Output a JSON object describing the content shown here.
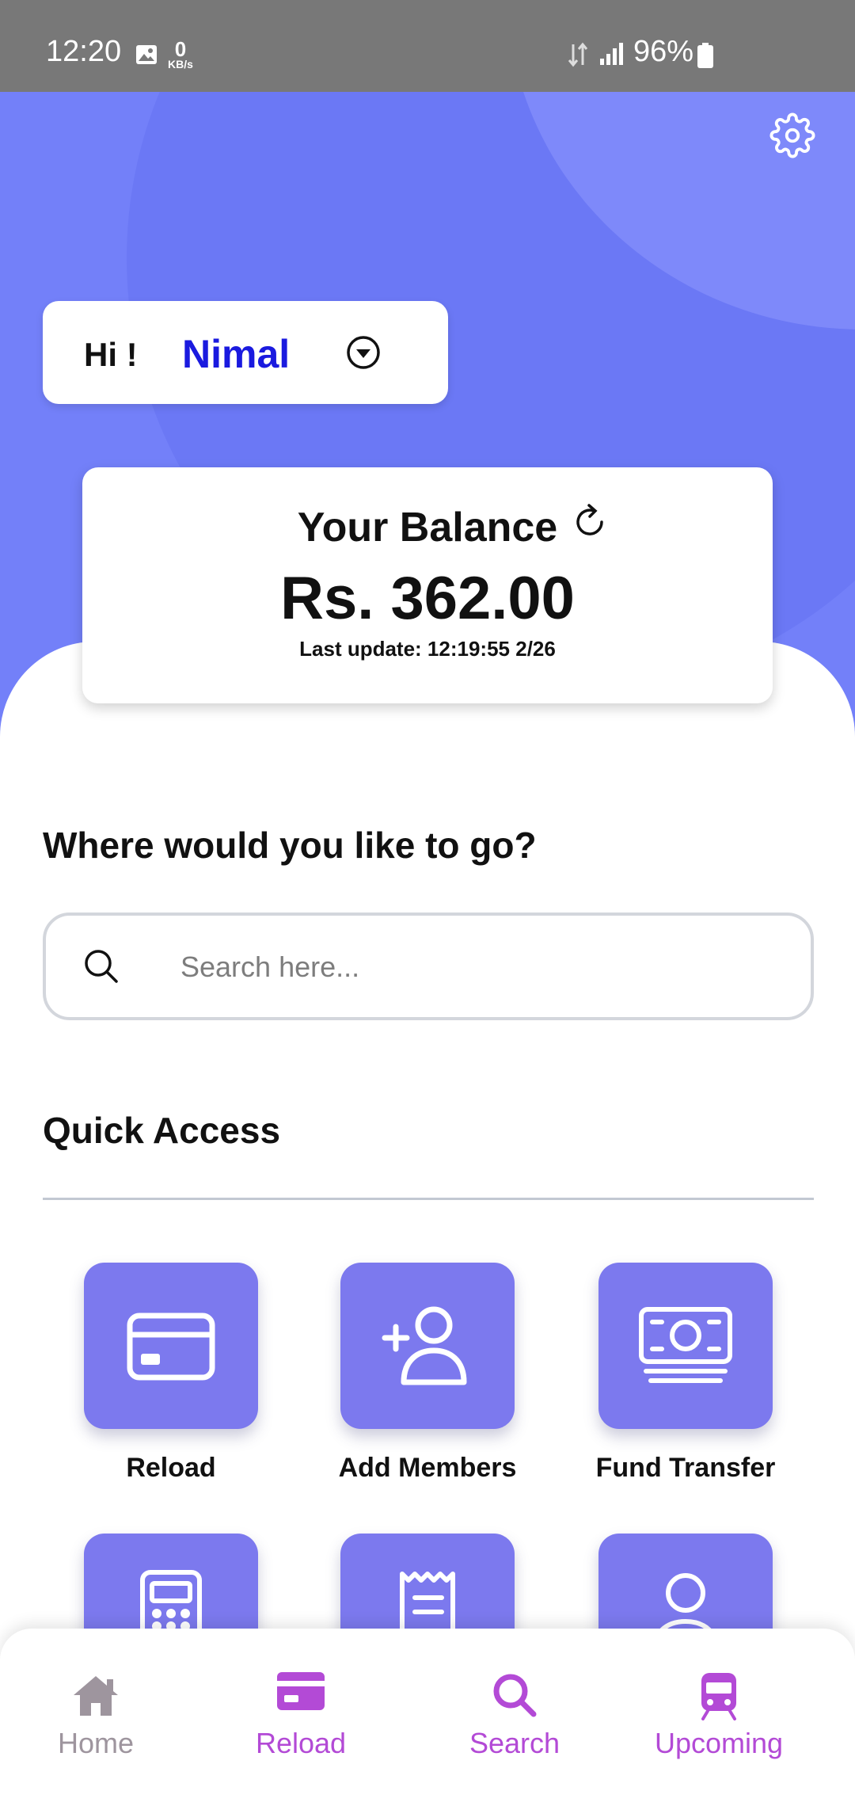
{
  "status_bar": {
    "time": "12:20",
    "speed_value": "0",
    "speed_unit": "KB/s",
    "battery": "96%"
  },
  "greeting": {
    "hi": "Hi !",
    "name": "Nimal"
  },
  "balance": {
    "title": "Your Balance",
    "amount": "Rs. 362.00",
    "last_update": "Last update: 12:19:55 2/26"
  },
  "destination": {
    "title": "Where would you like to go?",
    "search_placeholder": "Search here..."
  },
  "quick_access": {
    "title": "Quick Access",
    "items": [
      {
        "label": "Reload",
        "icon": "card-icon"
      },
      {
        "label": "Add Members",
        "icon": "add-user-icon"
      },
      {
        "label": "Fund Transfer",
        "icon": "cash-icon"
      },
      {
        "label": "",
        "icon": "calculator-icon"
      },
      {
        "label": "",
        "icon": "receipt-icon"
      },
      {
        "label": "",
        "icon": "profile-icon"
      }
    ]
  },
  "bottom_nav": {
    "items": [
      {
        "label": "Home",
        "icon": "home-icon"
      },
      {
        "label": "Reload",
        "icon": "card-icon"
      },
      {
        "label": "Search",
        "icon": "search-icon"
      },
      {
        "label": "Upcoming",
        "icon": "train-icon"
      }
    ]
  },
  "colors": {
    "hero": "#7380f9",
    "tile": "#7c79ee",
    "name": "#1a1adf",
    "nav_active": "#b34ad6",
    "nav_inactive": "#9e959e"
  }
}
